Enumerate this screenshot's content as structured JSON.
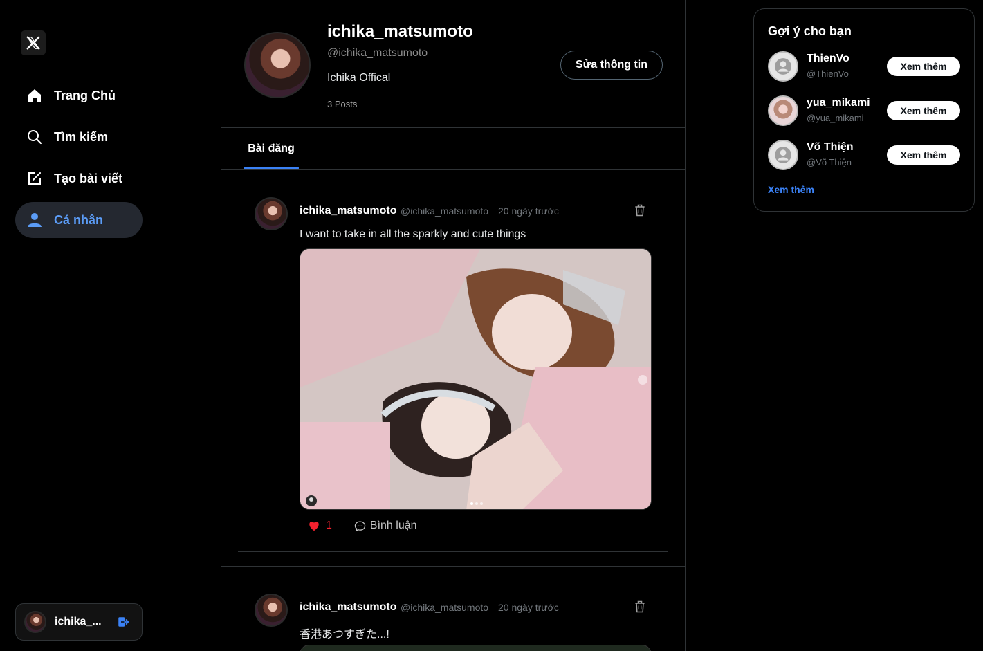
{
  "sidebar": {
    "logo": "X",
    "items": [
      {
        "label": "Trang Chủ",
        "icon": "home-icon"
      },
      {
        "label": "Tìm kiếm",
        "icon": "search-icon"
      },
      {
        "label": "Tạo bài viết",
        "icon": "compose-icon"
      },
      {
        "label": "Cá nhân",
        "icon": "user-icon",
        "active": true
      }
    ],
    "account": {
      "name": "ichika_...",
      "icon": "logout-icon"
    }
  },
  "profile": {
    "name": "ichika_matsumoto",
    "handle": "@ichika_matsumoto",
    "bio": "Ichika Offical",
    "posts_count": "3 Posts",
    "edit_label": "Sửa thông tin"
  },
  "tabs": [
    {
      "label": "Bài đăng",
      "active": true
    }
  ],
  "posts": [
    {
      "name": "ichika_matsumoto",
      "handle": "@ichika_matsumoto",
      "time": "20 ngày trước",
      "text": "I want to take in all the sparkly and cute things",
      "likes": "1",
      "comment_label": "Bình luận"
    },
    {
      "name": "ichika_matsumoto",
      "handle": "@ichika_matsumoto",
      "time": "20 ngày trước",
      "text": "香港あつすぎた...!"
    }
  ],
  "suggestions": {
    "title": "Gợi ý cho bạn",
    "users": [
      {
        "name": "ThienVo",
        "handle": "@ThienVo",
        "button": "Xem thêm",
        "avatar": "default"
      },
      {
        "name": "yua_mikami",
        "handle": "@yua_mikami",
        "button": "Xem thêm",
        "avatar": "photo"
      },
      {
        "name": "Võ Thiện",
        "handle": "@Võ Thiện",
        "button": "Xem thêm",
        "avatar": "default"
      }
    ],
    "more": "Xem thêm"
  },
  "colors": {
    "accent": "#3b82f6",
    "like": "#f4212e",
    "background": "#000000"
  }
}
